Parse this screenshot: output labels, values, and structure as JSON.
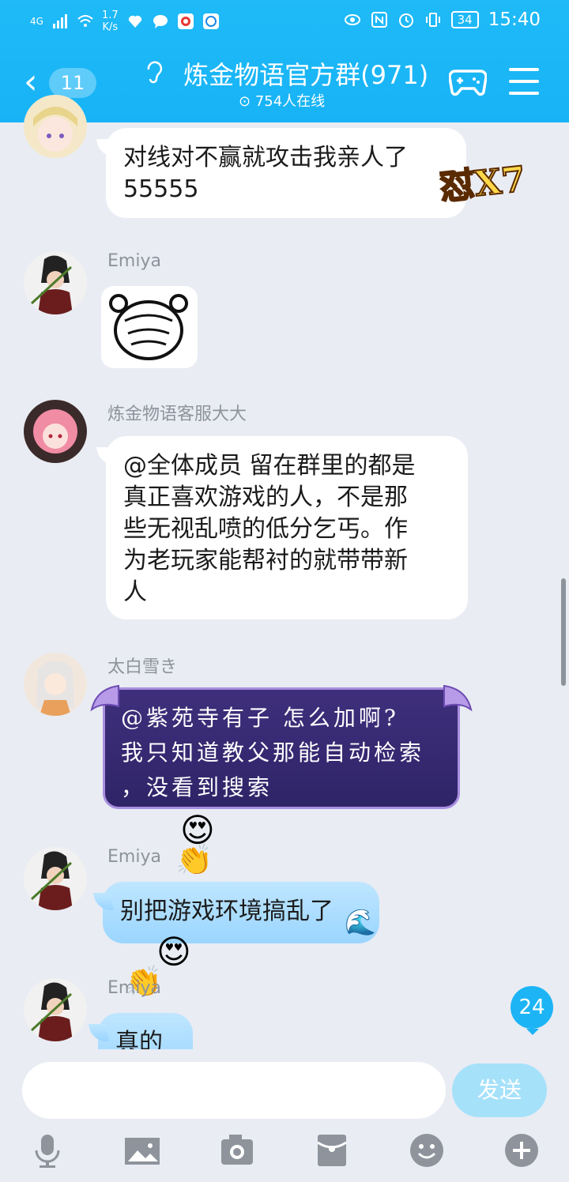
{
  "status_bar": {
    "signal_label": "4G",
    "speed": "1.7",
    "speed_unit": "K/s",
    "battery": "34",
    "time": "15:40"
  },
  "header": {
    "unread_count": "11",
    "title": "炼金物语官方群(971)",
    "online": "754人在线"
  },
  "messages": [
    {
      "sender": "",
      "text_line1": "对线对不赢就攻击我亲人了",
      "text_line2": "55555",
      "badge": "怼X7"
    },
    {
      "sender": "Emiya",
      "type": "sticker"
    },
    {
      "sender": "炼金物语客服大大",
      "lines": [
        "@全体成员 留在群里的都是",
        "真正喜欢游戏的人，不是那",
        "些无视乱喷的低分乞丐。作",
        "为老玩家能帮衬的就带带新",
        "人"
      ]
    },
    {
      "sender": "太白雪き",
      "lines": [
        "@紫苑寺有子 怎么加啊?",
        "我只知道教父那能自动检索",
        "，没看到搜索"
      ]
    },
    {
      "sender": "Emiya",
      "text": "别把游戏环境搞乱了"
    },
    {
      "sender": "Emiya",
      "text": "真的"
    }
  ],
  "unread_bubble": "24",
  "composer": {
    "placeholder": "",
    "send_label": "发送"
  },
  "colors": {
    "header": "#1fbaf7",
    "background": "#e9ecf3",
    "send": "#a6e1fa"
  }
}
